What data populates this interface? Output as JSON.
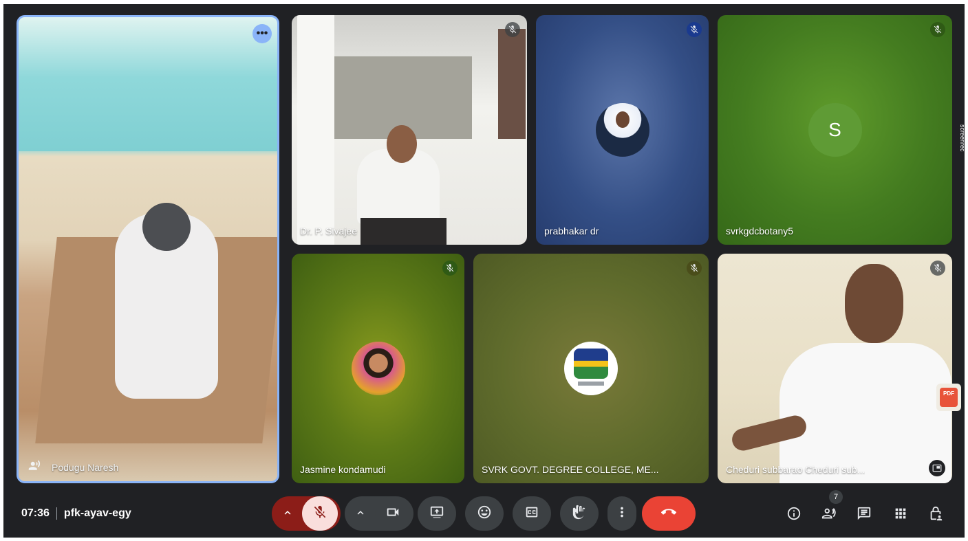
{
  "meeting": {
    "time": "07:36",
    "code": "pfk-ayav-egy",
    "participants_count": "7"
  },
  "tiles": {
    "naresh": {
      "name": "Podugu Naresh"
    },
    "sivajee": {
      "name": "Dr. P. Sivajee"
    },
    "prabhakar": {
      "name": "prabhakar dr"
    },
    "botany": {
      "name": "svrkgdcbotany5",
      "initial": "S"
    },
    "jasmine": {
      "name": "Jasmine kondamudi"
    },
    "college": {
      "name": "SVRK GOVT. DEGREE COLLEGE, ME..."
    },
    "subbarao": {
      "name": "Cheduri subbarao Cheduri sub..."
    }
  },
  "overlay": {
    "screenrec": "screenrec",
    "pdf": "PDF"
  },
  "colors": {
    "end_call": "#ea4335",
    "mic_off_bg": "#8c1d18",
    "bar_bg": "#202124"
  }
}
